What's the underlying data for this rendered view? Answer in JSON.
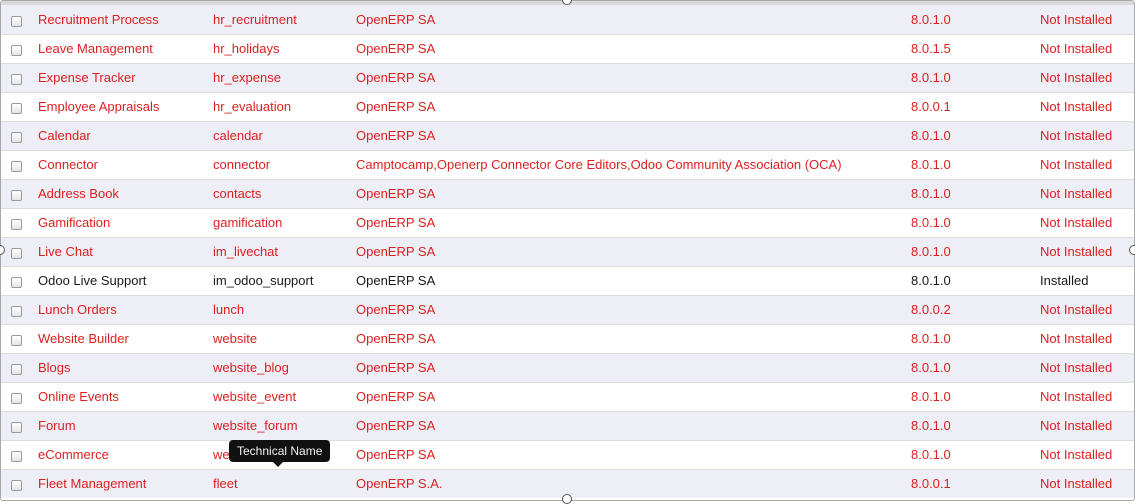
{
  "colors": {
    "not_installed_text": "#dd1f1f",
    "installed_text": "#1a1a1a",
    "row_alt": "#eeeef6"
  },
  "tooltip": {
    "text": "Technical Name"
  },
  "modules": [
    {
      "name": "Recruitment Process",
      "technical_name": "hr_recruitment",
      "author": "OpenERP SA",
      "version": "8.0.1.0",
      "state": "Not Installed"
    },
    {
      "name": "Leave Management",
      "technical_name": "hr_holidays",
      "author": "OpenERP SA",
      "version": "8.0.1.5",
      "state": "Not Installed"
    },
    {
      "name": "Expense Tracker",
      "technical_name": "hr_expense",
      "author": "OpenERP SA",
      "version": "8.0.1.0",
      "state": "Not Installed"
    },
    {
      "name": "Employee Appraisals",
      "technical_name": "hr_evaluation",
      "author": "OpenERP SA",
      "version": "8.0.0.1",
      "state": "Not Installed"
    },
    {
      "name": "Calendar",
      "technical_name": "calendar",
      "author": "OpenERP SA",
      "version": "8.0.1.0",
      "state": "Not Installed"
    },
    {
      "name": "Connector",
      "technical_name": "connector",
      "author": "Camptocamp,Openerp Connector Core Editors,Odoo Community Association (OCA)",
      "version": "8.0.1.0",
      "state": "Not Installed"
    },
    {
      "name": "Address Book",
      "technical_name": "contacts",
      "author": "OpenERP SA",
      "version": "8.0.1.0",
      "state": "Not Installed"
    },
    {
      "name": "Gamification",
      "technical_name": "gamification",
      "author": "OpenERP SA",
      "version": "8.0.1.0",
      "state": "Not Installed"
    },
    {
      "name": "Live Chat",
      "technical_name": "im_livechat",
      "author": "OpenERP SA",
      "version": "8.0.1.0",
      "state": "Not Installed"
    },
    {
      "name": "Odoo Live Support",
      "technical_name": "im_odoo_support",
      "author": "OpenERP SA",
      "version": "8.0.1.0",
      "state": "Installed"
    },
    {
      "name": "Lunch Orders",
      "technical_name": "lunch",
      "author": "OpenERP SA",
      "version": "8.0.0.2",
      "state": "Not Installed"
    },
    {
      "name": "Website Builder",
      "technical_name": "website",
      "author": "OpenERP SA",
      "version": "8.0.1.0",
      "state": "Not Installed"
    },
    {
      "name": "Blogs",
      "technical_name": "website_blog",
      "author": "OpenERP SA",
      "version": "8.0.1.0",
      "state": "Not Installed"
    },
    {
      "name": "Online Events",
      "technical_name": "website_event",
      "author": "OpenERP SA",
      "version": "8.0.1.0",
      "state": "Not Installed"
    },
    {
      "name": "Forum",
      "technical_name": "website_forum",
      "author": "OpenERP SA",
      "version": "8.0.1.0",
      "state": "Not Installed"
    },
    {
      "name": "eCommerce",
      "technical_name": "website_sale",
      "author": "OpenERP SA",
      "version": "8.0.1.0",
      "state": "Not Installed"
    },
    {
      "name": "Fleet Management",
      "technical_name": "fleet",
      "author": "OpenERP S.A.",
      "version": "8.0.0.1",
      "state": "Not Installed"
    }
  ]
}
